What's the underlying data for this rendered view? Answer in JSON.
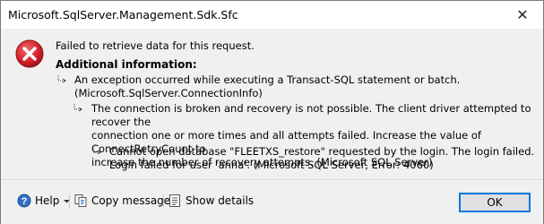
{
  "window": {
    "title": "Microsoft.SqlServer.Management.Sdk.Sfc",
    "close_glyph": "✕"
  },
  "message": {
    "main": "Failed to retrieve data for this request.",
    "additional_title": "Additional information:",
    "levels": [
      {
        "lines": [
          "An exception occurred while executing a Transact-SQL statement or batch.",
          "(Microsoft.SqlServer.ConnectionInfo)"
        ]
      },
      {
        "lines": [
          "The connection is broken and recovery is not possible.  The client driver attempted to recover the",
          "connection one or more times and all attempts failed.  Increase the value of ConnectRetryCount to",
          "increase the number of recovery attempts. (Microsoft SQL Server)"
        ]
      },
      {
        "lines": [
          "Cannot open database \"FLEETXS_restore\" requested by the login. The login failed.",
          "Login failed for user 'anna'. (Microsoft SQL Server, Error: 4060)"
        ]
      }
    ]
  },
  "footer": {
    "help_label": "Help",
    "copy_label": "Copy message",
    "details_label": "Show details",
    "ok_label": "OK"
  },
  "colors": {
    "error_red": "#e81123",
    "accent": "#0078d7"
  }
}
